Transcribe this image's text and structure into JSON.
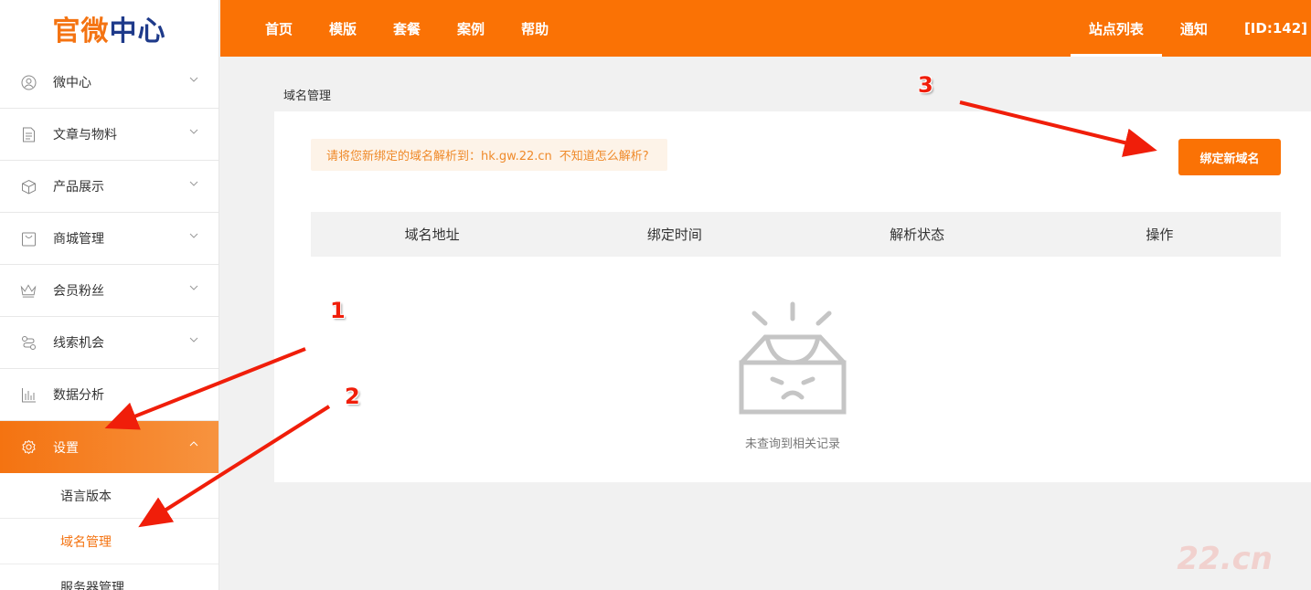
{
  "logo": {
    "part1": "官微",
    "part2": "中心"
  },
  "sidebar": {
    "items": [
      {
        "label": "微中心",
        "icon": "user-circle-icon"
      },
      {
        "label": "文章与物料",
        "icon": "document-icon"
      },
      {
        "label": "产品展示",
        "icon": "box-icon"
      },
      {
        "label": "商城管理",
        "icon": "shopping-bag-icon"
      },
      {
        "label": "会员粉丝",
        "icon": "crown-icon"
      },
      {
        "label": "线索机会",
        "icon": "route-icon"
      },
      {
        "label": "数据分析",
        "icon": "bar-chart-icon"
      },
      {
        "label": "设置",
        "icon": "gear-icon"
      }
    ],
    "sub_items": [
      {
        "label": "语言版本"
      },
      {
        "label": "域名管理"
      },
      {
        "label": "服务器管理"
      }
    ]
  },
  "topbar": {
    "nav": [
      "首页",
      "模版",
      "套餐",
      "案例",
      "帮助"
    ],
    "right": [
      "站点列表",
      "通知",
      "[ID:142]"
    ]
  },
  "main": {
    "breadcrumb": "域名管理",
    "notice_text": "请将您新绑定的域名解析到：hk.gw.22.cn",
    "notice_link": "不知道怎么解析?",
    "bind_button": "绑定新域名",
    "table_headers": [
      "域名地址",
      "绑定时间",
      "解析状态",
      "操作"
    ],
    "empty_text": "未查询到相关记录"
  },
  "annotations": [
    "1",
    "2",
    "3"
  ],
  "watermark": "22.cn",
  "colors": {
    "accent": "#fa7205",
    "arrow": "#f01e0a",
    "logo_orange": "#f47311",
    "logo_blue": "#1e3a8a"
  }
}
